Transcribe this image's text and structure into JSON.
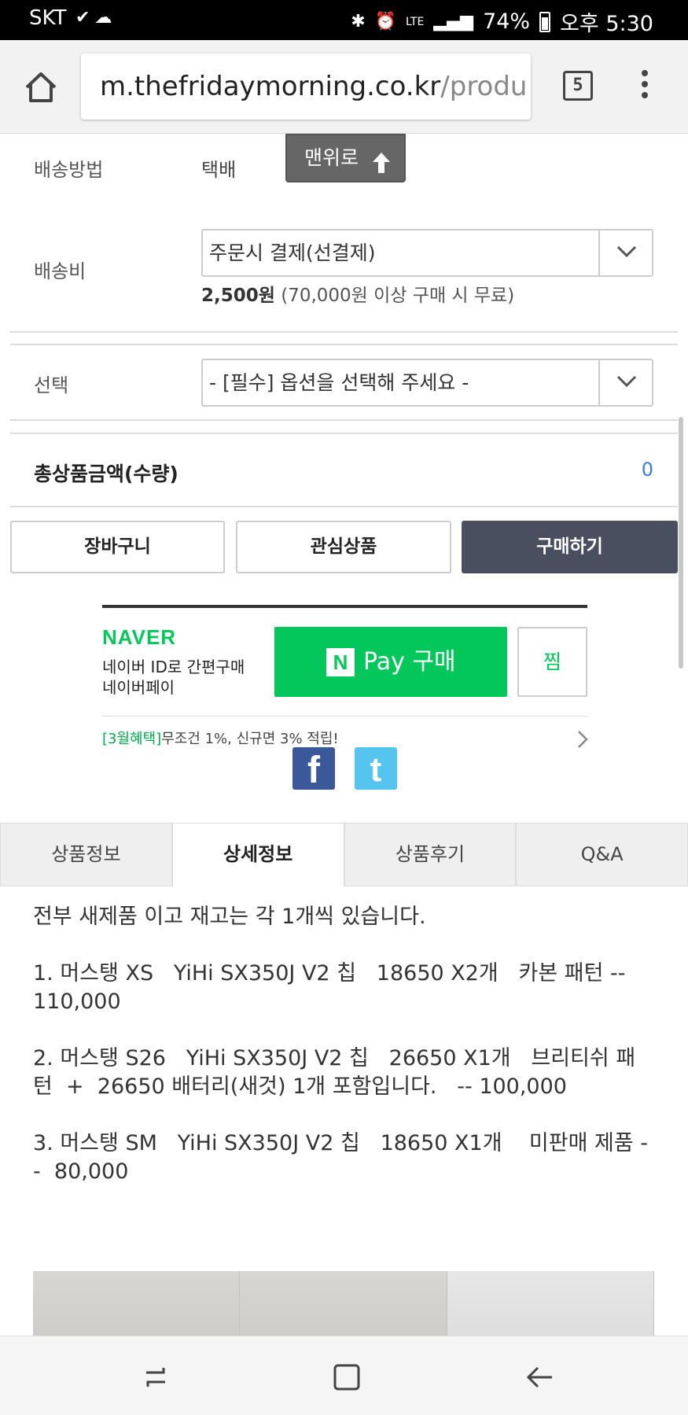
{
  "status_bar": {
    "carrier": "SKT",
    "network": "LTE",
    "battery": "74%",
    "time": "오후 5:30"
  },
  "browser": {
    "url_host": "m.thefridaymorning.co.kr",
    "url_path": "/produ",
    "tab_count": "5"
  },
  "shipping": {
    "method_label": "배송방법",
    "method_value": "택배",
    "fee_label": "배송비",
    "fee_select": "주문시 결제(선결제)",
    "fee_amount": "2,500원",
    "fee_note": " (70,000원 이상 구매 시 무료)"
  },
  "scroll_top_button": "맨위로",
  "option": {
    "label": "선택",
    "select": "- [필수] 옵션을 선택해 주세요 -"
  },
  "total": {
    "label": "총상품금액(수량)",
    "value": "0"
  },
  "actions": {
    "cart": "장바구니",
    "wishlist": "관심상품",
    "buy": "구매하기"
  },
  "naver": {
    "logo": "NAVER",
    "line1": "네이버 ID로 간편구매",
    "line2": "네이버페이",
    "pay_button": "Pay 구매",
    "pay_icon_letter": "N",
    "zzim": "찜",
    "promo_highlight": "[3월혜택]",
    "promo_text": "무조건 1%, 신규면 3% 적립!"
  },
  "social": {
    "facebook": "f",
    "twitter": "t"
  },
  "tabs": [
    {
      "label": "상품정보",
      "active": false
    },
    {
      "label": "상세정보",
      "active": true
    },
    {
      "label": "상품후기",
      "active": false
    },
    {
      "label": "Q&A",
      "active": false
    }
  ],
  "description": [
    "전부 새제품 이고 재고는 각 1개씩 있습니다.",
    "1. 머스탱 XS   YiHi SX350J V2 칩   18650 X2개   카본 패턴 -- 110,000",
    "2. 머스탱 S26   YiHi SX350J V2 칩   26650 X1개   브리티쉬 패턴  +  26650 배터리(새것) 1개 포함입니다.   -- 100,000",
    "3. 머스탱 SM   YiHi SX350J V2 칩   18650 X1개    미판매 제품 --  80,000"
  ],
  "colors": {
    "naver_green": "#03c75a",
    "buy_button": "#4a4f5f",
    "total_value": "#3b7dd8"
  }
}
